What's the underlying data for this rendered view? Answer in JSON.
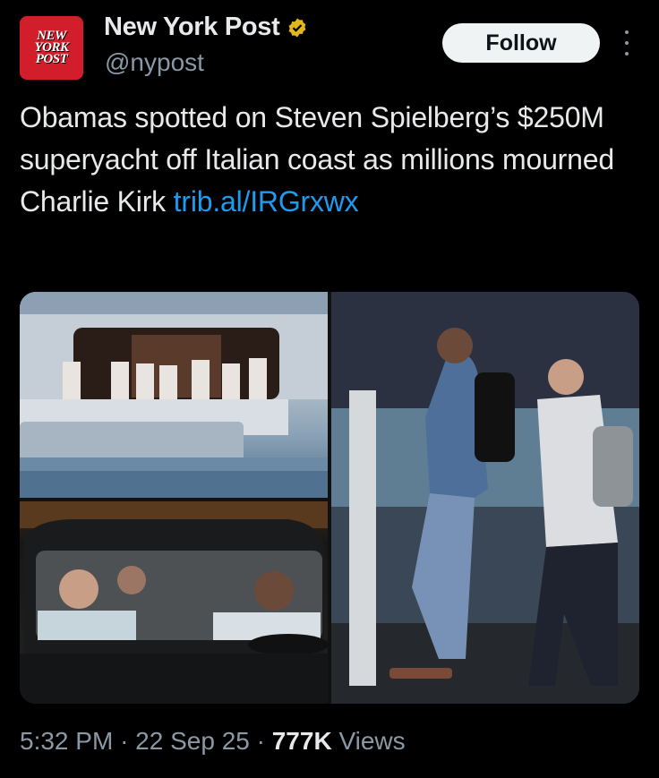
{
  "account": {
    "logo_text": [
      "NEW",
      "YORK",
      "POST"
    ],
    "name": "New York Post",
    "handle": "@nypost",
    "verified_badge_icon": "verified-badge-icon",
    "badge_color": "#e2b719"
  },
  "actions": {
    "follow_label": "Follow",
    "more_icon": "more-vertical-icon"
  },
  "tweet": {
    "text": "Obamas spotted on Steven Spielberg’s $250M superyacht off Italian coast as millions mourned Charlie Kirk ",
    "link": "trib.al/IRGrxwx"
  },
  "media": {
    "count": 3
  },
  "meta": {
    "time": "5:32 PM",
    "separator": "·",
    "date": "22 Sep 25",
    "views_count": "777K",
    "views_label": "Views"
  },
  "colors": {
    "background": "#000000",
    "text": "#e7e9ea",
    "muted": "#8b98a5",
    "link": "#1d9bf0",
    "brand": "#d11e2a"
  }
}
